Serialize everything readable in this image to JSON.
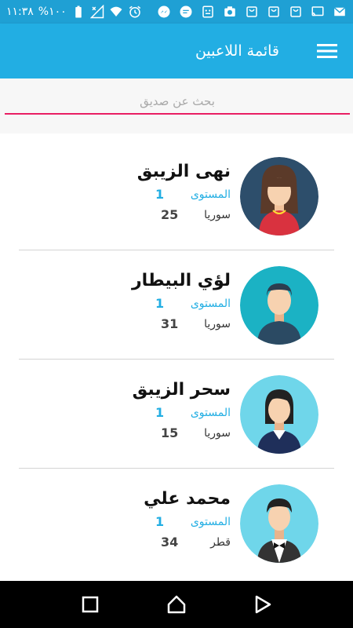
{
  "status_bar": {
    "time": "١١:٣٨",
    "battery": "%١٠٠",
    "colors": {
      "background": "#1fa0d4"
    },
    "icons": [
      "battery-icon",
      "no-signal-icon",
      "wifi-icon",
      "alarm-icon",
      "messenger-icon",
      "chat-icon",
      "robot-icon",
      "camera-icon",
      "shopping-bag-icon",
      "shopping-bag-icon",
      "shopping-bag-icon",
      "cast-icon",
      "email-icon"
    ]
  },
  "app_bar": {
    "title": "قائمة اللاعبين",
    "menu_icon": "hamburger-menu-icon",
    "colors": {
      "background": "#22aee3",
      "text": "#ffffff"
    }
  },
  "search": {
    "placeholder": "بحث عن صديق",
    "value": "",
    "colors": {
      "underline": "#e91e63"
    }
  },
  "players": [
    {
      "name": "نهى الزيبق",
      "level_label": "المستوى",
      "level": "1",
      "country": "سوريا",
      "age": "25",
      "avatar": "woman-long-hair-avatar"
    },
    {
      "name": "لؤي البيطار",
      "level_label": "المستوى",
      "level": "1",
      "country": "سوريا",
      "age": "31",
      "avatar": "man-avatar"
    },
    {
      "name": "سحر الزيبق",
      "level_label": "المستوى",
      "level": "1",
      "country": "سوريا",
      "age": "15",
      "avatar": "woman-business-avatar"
    },
    {
      "name": "محمد علي",
      "level_label": "المستوى",
      "level": "1",
      "country": "قطر",
      "age": "34",
      "avatar": "man-bowtie-avatar"
    }
  ],
  "nav_bar": {
    "buttons": [
      "recents-square-icon",
      "home-icon",
      "back-triangle-icon"
    ]
  }
}
